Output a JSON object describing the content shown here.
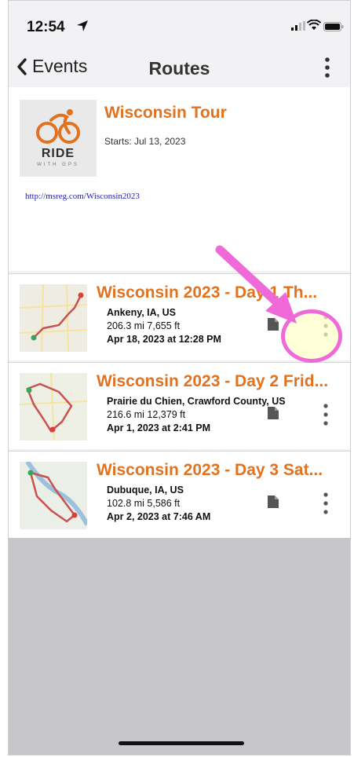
{
  "status_bar": {
    "time": "12:54"
  },
  "nav": {
    "back_label": "Events",
    "title": "Routes"
  },
  "event": {
    "title": "Wisconsin Tour",
    "starts": "Starts: Jul 13, 2023",
    "link": "http://msreg.com/Wisconsin2023",
    "logo_text": "RIDE",
    "logo_subtext": "WITH GPS"
  },
  "routes": [
    {
      "title": "Wisconsin 2023 - Day 1 Th...",
      "location": "Ankeny, IA, US",
      "stats": "206.3 mi 7,655 ft",
      "date": "Apr 18, 2023 at 12:28 PM"
    },
    {
      "title": "Wisconsin 2023 - Day 2 Frid...",
      "location": "Prairie du Chien, Crawford County, US",
      "stats": "216.6 mi 12,379 ft",
      "date": "Apr 1, 2023 at 2:41 PM"
    },
    {
      "title": "Wisconsin 2023 - Day 3 Sat...",
      "location": "Dubuque, IA, US",
      "stats": "102.8 mi 5,586 ft",
      "date": "Apr 2, 2023 at 7:46 AM"
    }
  ],
  "colors": {
    "accent": "#e1721f",
    "annotation": "#ef6ad8"
  },
  "icons": [
    "location-arrow-icon",
    "signal-icon",
    "wifi-icon",
    "battery-icon",
    "chevron-left-icon",
    "more-vertical-icon",
    "document-icon"
  ]
}
